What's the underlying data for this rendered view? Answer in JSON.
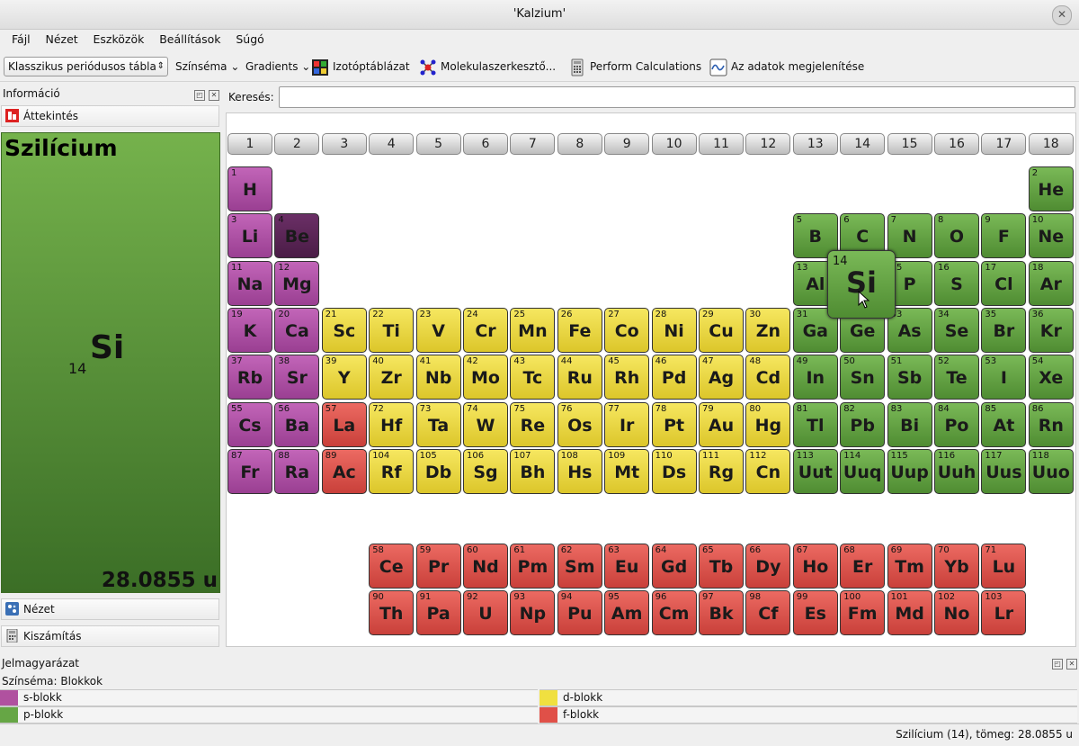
{
  "window": {
    "title": "'Kalzium'"
  },
  "menu": [
    "Fájl",
    "Nézet",
    "Eszközök",
    "Beállítások",
    "Súgó"
  ],
  "toolbar": {
    "table_select": "Klasszikus periódusos tábla",
    "color_scheme": "Színséma",
    "gradients": "Gradients",
    "isotope": "Izotóptáblázat",
    "molecule": "Molekulaszerkesztő...",
    "calculate": "Perform Calculations",
    "plot": "Az adatok megjelenítése"
  },
  "sidebar": {
    "title": "Információ",
    "overview": "Áttekintés",
    "view": "Nézet",
    "calc": "Kiszámítás",
    "element": {
      "name": "Szilícium",
      "number": "14",
      "symbol": "Si",
      "mass": "28.0855 u"
    }
  },
  "search": {
    "label": "Keresés:",
    "value": ""
  },
  "groups": [
    "1",
    "2",
    "3",
    "4",
    "5",
    "6",
    "7",
    "8",
    "9",
    "10",
    "11",
    "12",
    "13",
    "14",
    "15",
    "16",
    "17",
    "18"
  ],
  "elements": [
    {
      "n": 1,
      "s": "H",
      "r": 1,
      "c": 1,
      "b": "s"
    },
    {
      "n": 2,
      "s": "He",
      "r": 1,
      "c": 18,
      "b": "p"
    },
    {
      "n": 3,
      "s": "Li",
      "r": 2,
      "c": 1,
      "b": "s"
    },
    {
      "n": 4,
      "s": "Be",
      "r": 2,
      "c": 2,
      "b": "sel"
    },
    {
      "n": 5,
      "s": "B",
      "r": 2,
      "c": 13,
      "b": "p"
    },
    {
      "n": 6,
      "s": "C",
      "r": 2,
      "c": 14,
      "b": "p"
    },
    {
      "n": 7,
      "s": "N",
      "r": 2,
      "c": 15,
      "b": "p"
    },
    {
      "n": 8,
      "s": "O",
      "r": 2,
      "c": 16,
      "b": "p"
    },
    {
      "n": 9,
      "s": "F",
      "r": 2,
      "c": 17,
      "b": "p"
    },
    {
      "n": 10,
      "s": "Ne",
      "r": 2,
      "c": 18,
      "b": "p"
    },
    {
      "n": 11,
      "s": "Na",
      "r": 3,
      "c": 1,
      "b": "s"
    },
    {
      "n": 12,
      "s": "Mg",
      "r": 3,
      "c": 2,
      "b": "s"
    },
    {
      "n": 13,
      "s": "Al",
      "r": 3,
      "c": 13,
      "b": "p"
    },
    {
      "n": 15,
      "s": "P",
      "r": 3,
      "c": 15,
      "b": "p"
    },
    {
      "n": 16,
      "s": "S",
      "r": 3,
      "c": 16,
      "b": "p"
    },
    {
      "n": 17,
      "s": "Cl",
      "r": 3,
      "c": 17,
      "b": "p"
    },
    {
      "n": 18,
      "s": "Ar",
      "r": 3,
      "c": 18,
      "b": "p"
    },
    {
      "n": 19,
      "s": "K",
      "r": 4,
      "c": 1,
      "b": "s"
    },
    {
      "n": 20,
      "s": "Ca",
      "r": 4,
      "c": 2,
      "b": "s"
    },
    {
      "n": 21,
      "s": "Sc",
      "r": 4,
      "c": 3,
      "b": "d"
    },
    {
      "n": 22,
      "s": "Ti",
      "r": 4,
      "c": 4,
      "b": "d"
    },
    {
      "n": 23,
      "s": "V",
      "r": 4,
      "c": 5,
      "b": "d"
    },
    {
      "n": 24,
      "s": "Cr",
      "r": 4,
      "c": 6,
      "b": "d"
    },
    {
      "n": 25,
      "s": "Mn",
      "r": 4,
      "c": 7,
      "b": "d"
    },
    {
      "n": 26,
      "s": "Fe",
      "r": 4,
      "c": 8,
      "b": "d"
    },
    {
      "n": 27,
      "s": "Co",
      "r": 4,
      "c": 9,
      "b": "d"
    },
    {
      "n": 28,
      "s": "Ni",
      "r": 4,
      "c": 10,
      "b": "d"
    },
    {
      "n": 29,
      "s": "Cu",
      "r": 4,
      "c": 11,
      "b": "d"
    },
    {
      "n": 30,
      "s": "Zn",
      "r": 4,
      "c": 12,
      "b": "d"
    },
    {
      "n": 31,
      "s": "Ga",
      "r": 4,
      "c": 13,
      "b": "p"
    },
    {
      "n": 32,
      "s": "Ge",
      "r": 4,
      "c": 14,
      "b": "p"
    },
    {
      "n": 33,
      "s": "As",
      "r": 4,
      "c": 15,
      "b": "p"
    },
    {
      "n": 34,
      "s": "Se",
      "r": 4,
      "c": 16,
      "b": "p"
    },
    {
      "n": 35,
      "s": "Br",
      "r": 4,
      "c": 17,
      "b": "p"
    },
    {
      "n": 36,
      "s": "Kr",
      "r": 4,
      "c": 18,
      "b": "p"
    },
    {
      "n": 37,
      "s": "Rb",
      "r": 5,
      "c": 1,
      "b": "s"
    },
    {
      "n": 38,
      "s": "Sr",
      "r": 5,
      "c": 2,
      "b": "s"
    },
    {
      "n": 39,
      "s": "Y",
      "r": 5,
      "c": 3,
      "b": "d"
    },
    {
      "n": 40,
      "s": "Zr",
      "r": 5,
      "c": 4,
      "b": "d"
    },
    {
      "n": 41,
      "s": "Nb",
      "r": 5,
      "c": 5,
      "b": "d"
    },
    {
      "n": 42,
      "s": "Mo",
      "r": 5,
      "c": 6,
      "b": "d"
    },
    {
      "n": 43,
      "s": "Tc",
      "r": 5,
      "c": 7,
      "b": "d"
    },
    {
      "n": 44,
      "s": "Ru",
      "r": 5,
      "c": 8,
      "b": "d"
    },
    {
      "n": 45,
      "s": "Rh",
      "r": 5,
      "c": 9,
      "b": "d"
    },
    {
      "n": 46,
      "s": "Pd",
      "r": 5,
      "c": 10,
      "b": "d"
    },
    {
      "n": 47,
      "s": "Ag",
      "r": 5,
      "c": 11,
      "b": "d"
    },
    {
      "n": 48,
      "s": "Cd",
      "r": 5,
      "c": 12,
      "b": "d"
    },
    {
      "n": 49,
      "s": "In",
      "r": 5,
      "c": 13,
      "b": "p"
    },
    {
      "n": 50,
      "s": "Sn",
      "r": 5,
      "c": 14,
      "b": "p"
    },
    {
      "n": 51,
      "s": "Sb",
      "r": 5,
      "c": 15,
      "b": "p"
    },
    {
      "n": 52,
      "s": "Te",
      "r": 5,
      "c": 16,
      "b": "p"
    },
    {
      "n": 53,
      "s": "I",
      "r": 5,
      "c": 17,
      "b": "p"
    },
    {
      "n": 54,
      "s": "Xe",
      "r": 5,
      "c": 18,
      "b": "p"
    },
    {
      "n": 55,
      "s": "Cs",
      "r": 6,
      "c": 1,
      "b": "s"
    },
    {
      "n": 56,
      "s": "Ba",
      "r": 6,
      "c": 2,
      "b": "s"
    },
    {
      "n": 57,
      "s": "La",
      "r": 6,
      "c": 3,
      "b": "f"
    },
    {
      "n": 72,
      "s": "Hf",
      "r": 6,
      "c": 4,
      "b": "d"
    },
    {
      "n": 73,
      "s": "Ta",
      "r": 6,
      "c": 5,
      "b": "d"
    },
    {
      "n": 74,
      "s": "W",
      "r": 6,
      "c": 6,
      "b": "d"
    },
    {
      "n": 75,
      "s": "Re",
      "r": 6,
      "c": 7,
      "b": "d"
    },
    {
      "n": 76,
      "s": "Os",
      "r": 6,
      "c": 8,
      "b": "d"
    },
    {
      "n": 77,
      "s": "Ir",
      "r": 6,
      "c": 9,
      "b": "d"
    },
    {
      "n": 78,
      "s": "Pt",
      "r": 6,
      "c": 10,
      "b": "d"
    },
    {
      "n": 79,
      "s": "Au",
      "r": 6,
      "c": 11,
      "b": "d"
    },
    {
      "n": 80,
      "s": "Hg",
      "r": 6,
      "c": 12,
      "b": "d"
    },
    {
      "n": 81,
      "s": "Tl",
      "r": 6,
      "c": 13,
      "b": "p"
    },
    {
      "n": 82,
      "s": "Pb",
      "r": 6,
      "c": 14,
      "b": "p"
    },
    {
      "n": 83,
      "s": "Bi",
      "r": 6,
      "c": 15,
      "b": "p"
    },
    {
      "n": 84,
      "s": "Po",
      "r": 6,
      "c": 16,
      "b": "p"
    },
    {
      "n": 85,
      "s": "At",
      "r": 6,
      "c": 17,
      "b": "p"
    },
    {
      "n": 86,
      "s": "Rn",
      "r": 6,
      "c": 18,
      "b": "p"
    },
    {
      "n": 87,
      "s": "Fr",
      "r": 7,
      "c": 1,
      "b": "s"
    },
    {
      "n": 88,
      "s": "Ra",
      "r": 7,
      "c": 2,
      "b": "s"
    },
    {
      "n": 89,
      "s": "Ac",
      "r": 7,
      "c": 3,
      "b": "f"
    },
    {
      "n": 104,
      "s": "Rf",
      "r": 7,
      "c": 4,
      "b": "d"
    },
    {
      "n": 105,
      "s": "Db",
      "r": 7,
      "c": 5,
      "b": "d"
    },
    {
      "n": 106,
      "s": "Sg",
      "r": 7,
      "c": 6,
      "b": "d"
    },
    {
      "n": 107,
      "s": "Bh",
      "r": 7,
      "c": 7,
      "b": "d"
    },
    {
      "n": 108,
      "s": "Hs",
      "r": 7,
      "c": 8,
      "b": "d"
    },
    {
      "n": 109,
      "s": "Mt",
      "r": 7,
      "c": 9,
      "b": "d"
    },
    {
      "n": 110,
      "s": "Ds",
      "r": 7,
      "c": 10,
      "b": "d"
    },
    {
      "n": 111,
      "s": "Rg",
      "r": 7,
      "c": 11,
      "b": "d"
    },
    {
      "n": 112,
      "s": "Cn",
      "r": 7,
      "c": 12,
      "b": "d"
    },
    {
      "n": 113,
      "s": "Uut",
      "r": 7,
      "c": 13,
      "b": "p"
    },
    {
      "n": 114,
      "s": "Uuq",
      "r": 7,
      "c": 14,
      "b": "p"
    },
    {
      "n": 115,
      "s": "Uup",
      "r": 7,
      "c": 15,
      "b": "p"
    },
    {
      "n": 116,
      "s": "Uuh",
      "r": 7,
      "c": 16,
      "b": "p"
    },
    {
      "n": 117,
      "s": "Uus",
      "r": 7,
      "c": 17,
      "b": "p"
    },
    {
      "n": 118,
      "s": "Uuo",
      "r": 7,
      "c": 18,
      "b": "p"
    },
    {
      "n": 58,
      "s": "Ce",
      "r": 9,
      "c": 4,
      "b": "f"
    },
    {
      "n": 59,
      "s": "Pr",
      "r": 9,
      "c": 5,
      "b": "f"
    },
    {
      "n": 60,
      "s": "Nd",
      "r": 9,
      "c": 6,
      "b": "f"
    },
    {
      "n": 61,
      "s": "Pm",
      "r": 9,
      "c": 7,
      "b": "f"
    },
    {
      "n": 62,
      "s": "Sm",
      "r": 9,
      "c": 8,
      "b": "f"
    },
    {
      "n": 63,
      "s": "Eu",
      "r": 9,
      "c": 9,
      "b": "f"
    },
    {
      "n": 64,
      "s": "Gd",
      "r": 9,
      "c": 10,
      "b": "f"
    },
    {
      "n": 65,
      "s": "Tb",
      "r": 9,
      "c": 11,
      "b": "f"
    },
    {
      "n": 66,
      "s": "Dy",
      "r": 9,
      "c": 12,
      "b": "f"
    },
    {
      "n": 67,
      "s": "Ho",
      "r": 9,
      "c": 13,
      "b": "f"
    },
    {
      "n": 68,
      "s": "Er",
      "r": 9,
      "c": 14,
      "b": "f"
    },
    {
      "n": 69,
      "s": "Tm",
      "r": 9,
      "c": 15,
      "b": "f"
    },
    {
      "n": 70,
      "s": "Yb",
      "r": 9,
      "c": 16,
      "b": "f"
    },
    {
      "n": 71,
      "s": "Lu",
      "r": 9,
      "c": 17,
      "b": "f"
    },
    {
      "n": 90,
      "s": "Th",
      "r": 10,
      "c": 4,
      "b": "f"
    },
    {
      "n": 91,
      "s": "Pa",
      "r": 10,
      "c": 5,
      "b": "f"
    },
    {
      "n": 92,
      "s": "U",
      "r": 10,
      "c": 6,
      "b": "f"
    },
    {
      "n": 93,
      "s": "Np",
      "r": 10,
      "c": 7,
      "b": "f"
    },
    {
      "n": 94,
      "s": "Pu",
      "r": 10,
      "c": 8,
      "b": "f"
    },
    {
      "n": 95,
      "s": "Am",
      "r": 10,
      "c": 9,
      "b": "f"
    },
    {
      "n": 96,
      "s": "Cm",
      "r": 10,
      "c": 10,
      "b": "f"
    },
    {
      "n": 97,
      "s": "Bk",
      "r": 10,
      "c": 11,
      "b": "f"
    },
    {
      "n": 98,
      "s": "Cf",
      "r": 10,
      "c": 12,
      "b": "f"
    },
    {
      "n": 99,
      "s": "Es",
      "r": 10,
      "c": 13,
      "b": "f"
    },
    {
      "n": 100,
      "s": "Fm",
      "r": 10,
      "c": 14,
      "b": "f"
    },
    {
      "n": 101,
      "s": "Md",
      "r": 10,
      "c": 15,
      "b": "f"
    },
    {
      "n": 102,
      "s": "No",
      "r": 10,
      "c": 16,
      "b": "f"
    },
    {
      "n": 103,
      "s": "Lr",
      "r": 10,
      "c": 17,
      "b": "f"
    }
  ],
  "hovered": {
    "n": "14",
    "s": "Si"
  },
  "legend": {
    "title": "Jelmagyarázat",
    "scheme": "Színséma: Blokkok",
    "items": [
      {
        "label": "s-blokk",
        "color": "#b0519f"
      },
      {
        "label": "d-blokk",
        "color": "#f0e040"
      },
      {
        "label": "p-blokk",
        "color": "#66a645"
      },
      {
        "label": "f-blokk",
        "color": "#e05048"
      }
    ]
  },
  "status": "Szilícium (14), tömeg: 28.0855 u"
}
